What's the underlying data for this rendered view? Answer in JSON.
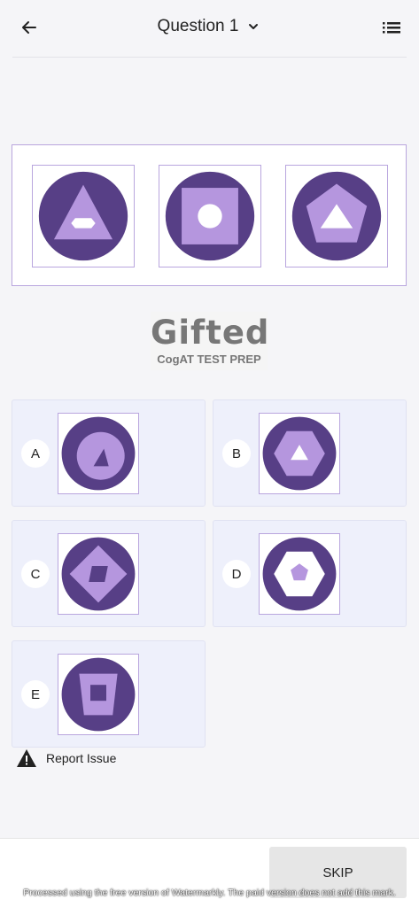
{
  "header": {
    "title": "Question 1",
    "back_icon": "arrow-left-icon",
    "dropdown_icon": "chevron-down-icon",
    "list_icon": "list-icon"
  },
  "colors": {
    "shape_dark": "#573f86",
    "shape_light": "#b596de",
    "frame_border": "#b9a6de",
    "option_bg": "#eef0fb"
  },
  "question": {
    "figures": [
      "circle-triangle-hexagon",
      "circle-square-circle",
      "circle-pentagon-triangle"
    ]
  },
  "logo": {
    "main": "Gifted",
    "sub": "CogAT TEST PREP"
  },
  "options": [
    {
      "label": "A",
      "figure": "circle-circle-triangle"
    },
    {
      "label": "B",
      "figure": "circle-hexagon-triangle"
    },
    {
      "label": "C",
      "figure": "circle-diamond-parallelogram"
    },
    {
      "label": "D",
      "figure": "circle-hexagon-pentagon"
    },
    {
      "label": "E",
      "figure": "circle-trapezoid-square"
    }
  ],
  "report": {
    "label": "Report Issue",
    "icon": "warning-icon"
  },
  "footer": {
    "skip_label": "SKIP",
    "watermark": "Processed using the free version of Watermarkly. The paid version does not add this mark."
  }
}
